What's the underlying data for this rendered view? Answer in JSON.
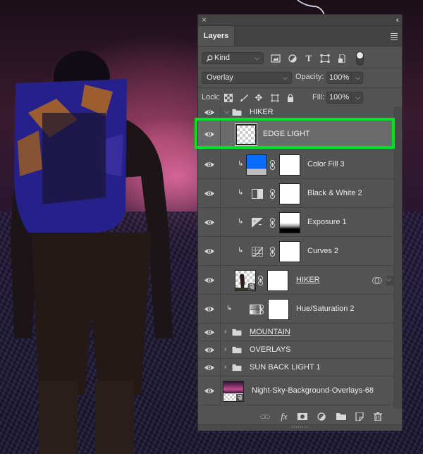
{
  "panel": {
    "close_glyph": "×",
    "collapse_glyph": "‹‹",
    "tab_label": "Layers",
    "menu_icon": "panel-menu-icon"
  },
  "filter": {
    "kind_label": "Kind",
    "kind_icon": "search-icon",
    "icons": [
      "pixel-layer-filter-icon",
      "adjustment-layer-filter-icon",
      "type-layer-filter-icon",
      "shape-layer-filter-icon",
      "smart-object-filter-icon"
    ],
    "type_glyph": "T",
    "toggle_on": true
  },
  "blend": {
    "mode": "Overlay",
    "opacity_label": "Opacity:",
    "opacity_value": "100%",
    "lock_label": "Lock:",
    "fill_label": "Fill:",
    "fill_value": "100%",
    "lock_icons": [
      "lock-transparent-icon",
      "lock-image-icon",
      "lock-position-icon",
      "lock-artboard-icon",
      "lock-all-icon"
    ]
  },
  "layers": [
    {
      "name": "HIKER",
      "type": "group",
      "expanded": true,
      "visible": true
    },
    {
      "name": "EDGE LIGHT",
      "type": "pixel",
      "visible": true,
      "selected": true,
      "highlighted": true
    },
    {
      "name": "Color Fill 3",
      "type": "fill",
      "clipped": true,
      "visible": true,
      "fill_color": "#0a6cff"
    },
    {
      "name": "Black & White 2",
      "type": "adjustment",
      "adjustment": "black-white",
      "clipped": true,
      "visible": true
    },
    {
      "name": "Exposure 1",
      "type": "adjustment",
      "adjustment": "exposure",
      "clipped": true,
      "visible": true
    },
    {
      "name": "Curves 2",
      "type": "adjustment",
      "adjustment": "curves",
      "clipped": true,
      "visible": true
    },
    {
      "name": "HIKER",
      "type": "smart-object",
      "visible": true,
      "underlined": true,
      "blend_if_icon": true
    },
    {
      "name": "Hue/Saturation 2",
      "type": "adjustment",
      "adjustment": "hue-saturation",
      "clipped": true,
      "visible": true
    },
    {
      "name": "MOUNTAIN",
      "type": "group",
      "expanded": false,
      "visible": true,
      "underlined": true
    },
    {
      "name": "OVERLAYS",
      "type": "group",
      "expanded": false,
      "visible": true
    },
    {
      "name": "SUN BACK LIGHT 1",
      "type": "group",
      "expanded": false,
      "visible": true
    },
    {
      "name": "Night-Sky-Background-Overlays-68",
      "type": "smart-object",
      "visible": true
    }
  ],
  "bottom_bar": {
    "fx_label": "fx",
    "icons": [
      "link-layers-icon",
      "add-layer-style-icon",
      "add-mask-icon",
      "new-adjustment-layer-icon",
      "new-group-icon",
      "new-layer-icon",
      "delete-layer-icon"
    ]
  },
  "colors": {
    "highlight": "#00e31c",
    "panel_bg": "#535353",
    "selected_row": "#6b6b6b",
    "fill_swatch": "#0a6cff"
  }
}
